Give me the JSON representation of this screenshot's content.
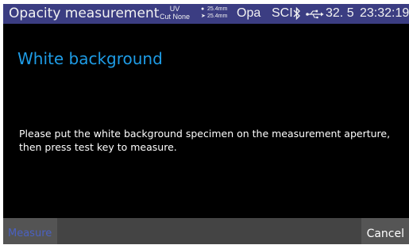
{
  "status_bar": {
    "title": "Opacity measurement",
    "uv_label": "UV",
    "uv_value": "Cut None",
    "aperture_illum": "25.4mm",
    "aperture_view": "25.4mm",
    "mode": "Opa",
    "geometry": "SCI",
    "temperature": "32. 5",
    "time": "23:32:19",
    "colors": {
      "background": "#3b3d82",
      "text": "#f2f2f2"
    },
    "icons": [
      "bluetooth-icon",
      "usb-icon"
    ]
  },
  "main": {
    "heading": "White background",
    "message": "Please put the white background specimen on the measurement aperture, then press test key to measure.",
    "heading_color": "#1e9ce6"
  },
  "footer": {
    "measure_label": "Measure",
    "cancel_label": "Cancel"
  }
}
